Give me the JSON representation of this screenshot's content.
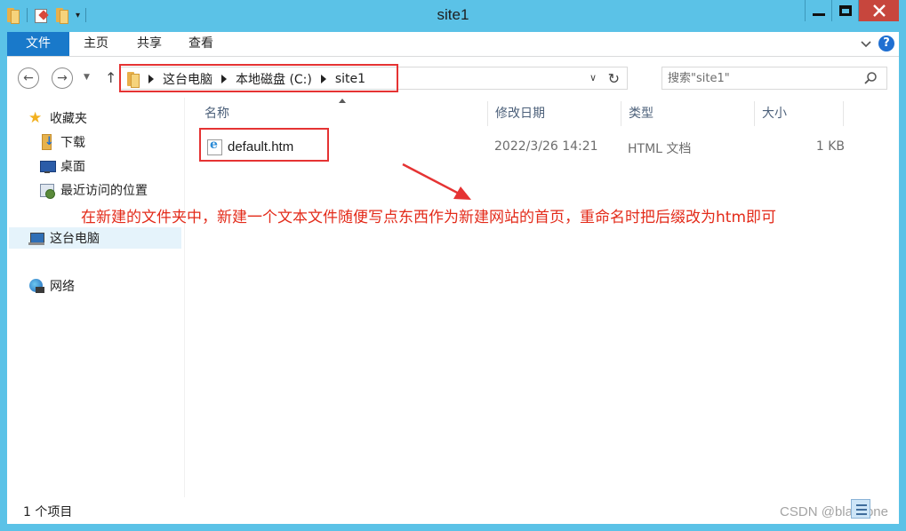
{
  "window": {
    "title": "site1",
    "accent": "#5bc2e7"
  },
  "ribbon": {
    "tabs": [
      "文件",
      "主页",
      "共享",
      "查看"
    ],
    "file_tab_color": "#1979ca",
    "help_label": "?"
  },
  "navigation": {
    "crumbs": [
      "这台电脑",
      "本地磁盘 (C:)",
      "site1"
    ],
    "search_placeholder": "搜索\"site1\""
  },
  "sidebar": {
    "items": [
      {
        "label": "收藏夹",
        "icon": "star-icon"
      },
      {
        "label": "下载",
        "icon": "download-folder-icon"
      },
      {
        "label": "桌面",
        "icon": "desktop-icon"
      },
      {
        "label": "最近访问的位置",
        "icon": "recent-places-icon"
      },
      {
        "label": "这台电脑",
        "icon": "computer-icon",
        "selected": true
      },
      {
        "label": "网络",
        "icon": "network-icon"
      }
    ]
  },
  "file_list": {
    "columns": [
      "名称",
      "修改日期",
      "类型",
      "大小"
    ],
    "rows": [
      {
        "name": "default.htm",
        "date": "2022/3/26 14:21",
        "type": "HTML 文档",
        "size": "1 KB",
        "icon": "ie-html-icon"
      }
    ]
  },
  "annotation": {
    "text": "在新建的文件夹中，新建一个文本文件随便写点东西作为新建网站的首页，重命名时把后缀改为htm即可",
    "color": "#e32b1a"
  },
  "status": {
    "item_count": "1 个项目"
  },
  "watermark": "CSDN @blackone"
}
